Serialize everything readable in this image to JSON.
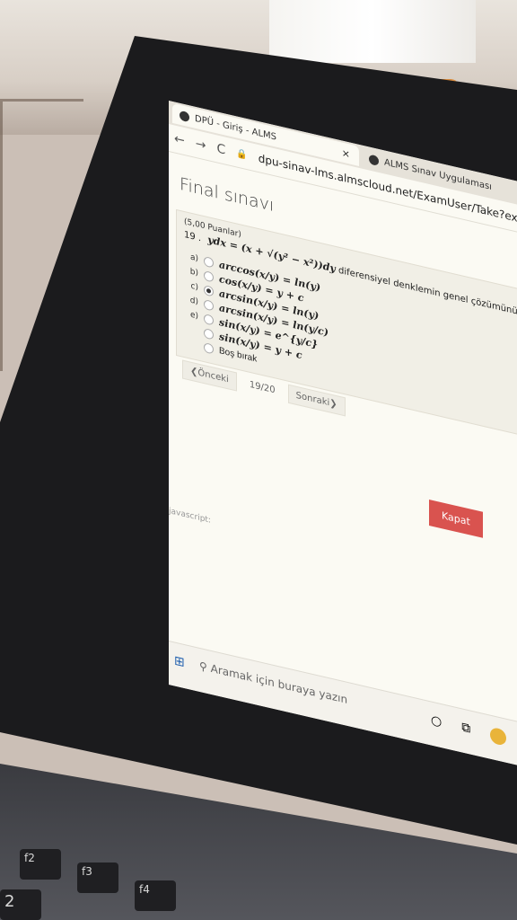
{
  "browser": {
    "tabs": [
      {
        "label": "DPÜ - Giriş - ALMS",
        "close": "×"
      },
      {
        "label": "ALMS Sınav Uygulaması",
        "close": "×"
      }
    ],
    "nav_buttons": {
      "back": "←",
      "forward": "→",
      "reload": "C"
    },
    "url": "dpu-sinav-lms.almscloud.net/ExamUser/Take?examSessio"
  },
  "page": {
    "title": "Final sınavı",
    "question": {
      "points": "(5,00 Puanlar)",
      "number": "19 .",
      "equation": "ydx = (x + √(y² − x²))dy",
      "text": "diferensiyel denklemin genel çözümünü bulunuz."
    },
    "options": [
      {
        "letter": "a)",
        "text": "arccos(x/y) = ln(y)",
        "checked": false
      },
      {
        "letter": "b)",
        "text": "cos(x/y) = y + c",
        "checked": false
      },
      {
        "letter": "c)",
        "text": "arcsin(x/y) = ln(y)",
        "checked": true
      },
      {
        "letter": "d)",
        "text": "arcsin(x/y) = ln(y/c)",
        "checked": false
      },
      {
        "letter": "e)",
        "text": "sin(x/y) = e^{y/c}",
        "checked": false
      },
      {
        "letter": "",
        "text": "sin(x/y) = y + c",
        "checked": false
      }
    ],
    "skip_label": "Boş bırak",
    "prev_label": "Önceki",
    "page_indicator": "19/20",
    "next_label": "Sonraki",
    "close_label": "Kapat",
    "status_text": "javascript:"
  },
  "taskbar": {
    "search_placeholder": "Aramak için buraya yazın"
  },
  "keyboard": {
    "keys": [
      "f2",
      "f3",
      "f4",
      "2"
    ]
  }
}
